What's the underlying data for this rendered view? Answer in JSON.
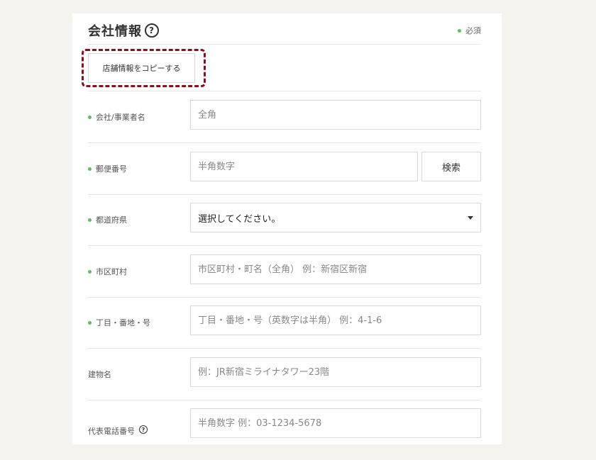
{
  "section": {
    "title": "会社情報",
    "help_icon": "?",
    "required_note": "必須",
    "copy_button": "店舗情報をコピーする"
  },
  "fields": {
    "company_name": {
      "label": "会社/事業者名",
      "placeholder": "全角"
    },
    "postal_code": {
      "label": "郵便番号",
      "placeholder": "半角数字",
      "search_button": "検索"
    },
    "prefecture": {
      "label": "都道府県",
      "selected": "選択してください。"
    },
    "city": {
      "label": "市区町村",
      "placeholder": "市区町村・町名（全角） 例：新宿区新宿"
    },
    "address": {
      "label": "丁目・番地・号",
      "placeholder": "丁目・番地・号（英数字は半角） 例：4-1-6"
    },
    "building": {
      "label": "建物名",
      "placeholder": "例：JR新宿ミライナタワー23階"
    },
    "phone": {
      "label": "代表電話番号",
      "placeholder": "半角数字 例：03-1234-5678",
      "help_icon": "?"
    }
  },
  "colors": {
    "required_dot": "#5fbf5f",
    "highlight": "#8b0f1f",
    "background": "#f5f3ee"
  }
}
